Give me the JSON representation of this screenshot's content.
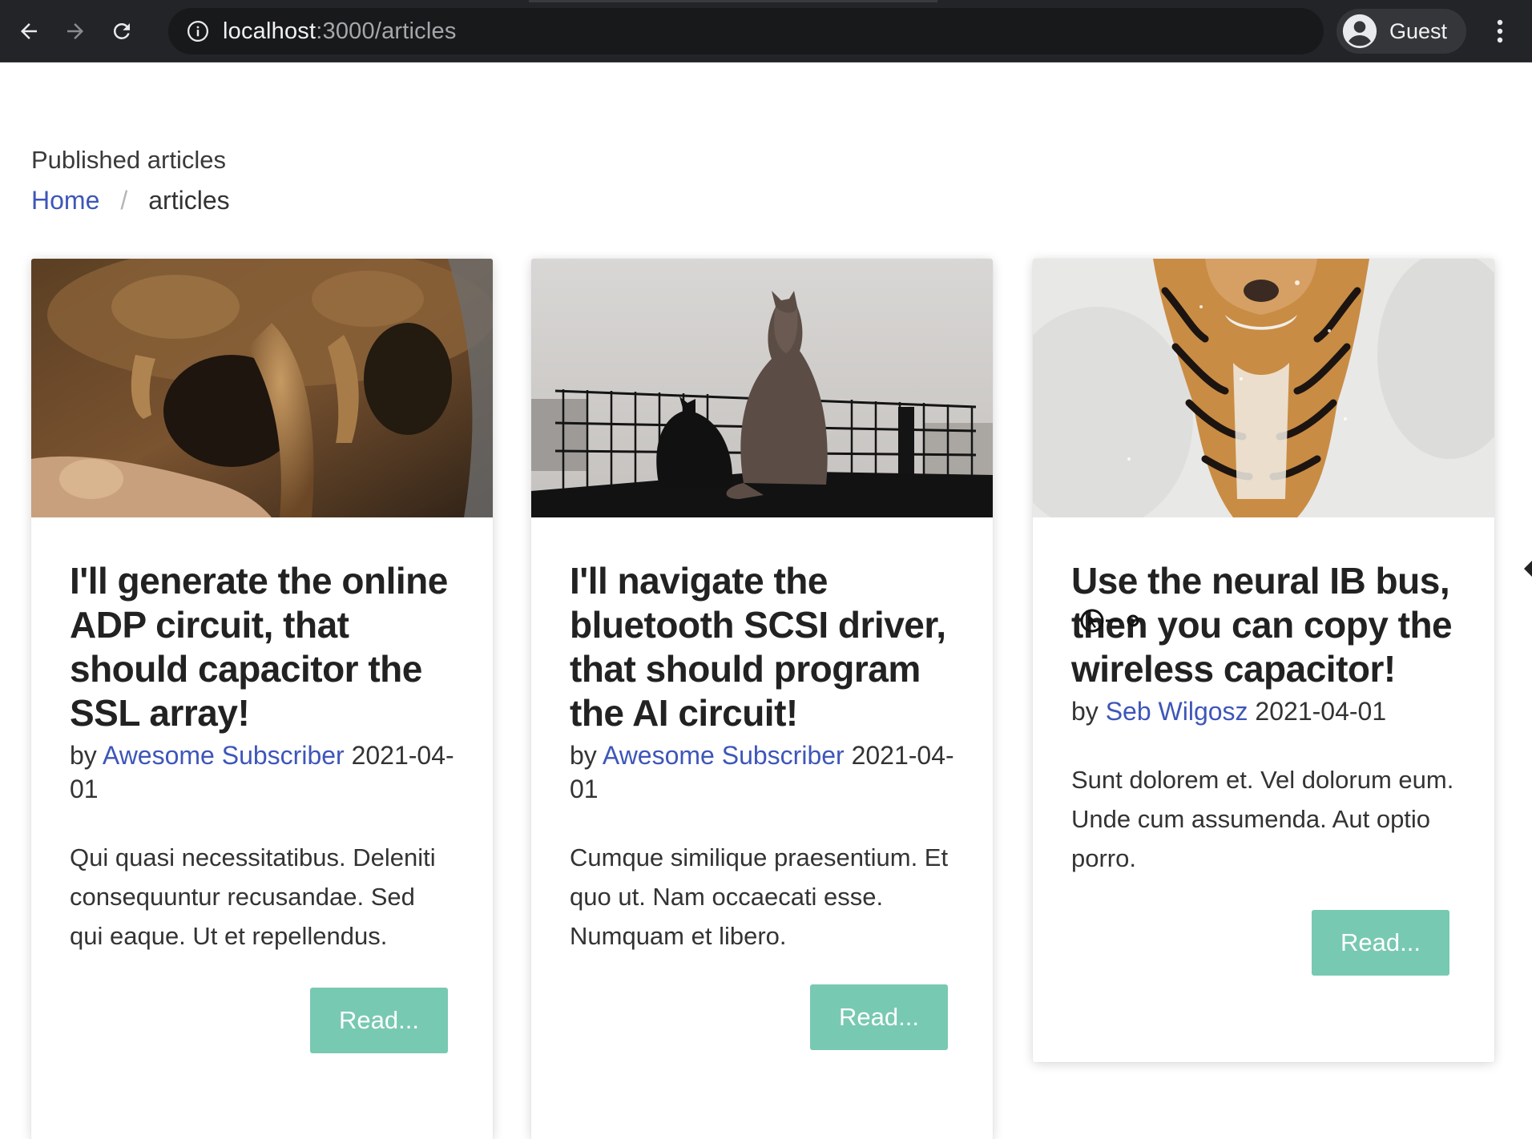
{
  "browser": {
    "url_host": "localhost",
    "url_path": ":3000/articles",
    "profile_label": "Guest",
    "icons": [
      "back-arrow-icon",
      "forward-arrow-icon",
      "reload-icon",
      "info-icon",
      "profile-avatar-icon",
      "kebab-menu-icon"
    ]
  },
  "page": {
    "heading": "Published articles",
    "breadcrumb": {
      "home": "Home",
      "separator": "/",
      "current": "articles"
    }
  },
  "articles": [
    {
      "title": "I'll generate the online ADP circuit, that should capacitor the SSL array!",
      "by": "by",
      "author": "Awesome Subscriber",
      "date": "2021-04-01",
      "excerpt": "Qui quasi necessitatibus. Deleniti consequuntur recusandae. Sed qui eaque. Ut et repellendus.",
      "read_label": "Read...",
      "image": "sabertooth-skull"
    },
    {
      "title": "I'll navigate the bluetooth SCSI driver, that should program the AI circuit!",
      "by": "by",
      "author": "Awesome Subscriber",
      "date": "2021-04-01",
      "excerpt": "Cumque similique praesentium. Et quo ut. Nam occaecati esse. Numquam et libero.",
      "read_label": "Read...",
      "image": "cats-on-fence"
    },
    {
      "title": "Use the neural IB bus, then you can copy the wireless capacitor!",
      "by": "by",
      "author": "Seb Wilgosz",
      "date": "2021-04-01",
      "excerpt": "Sunt dolorem et. Vel dolorum eum. Unde cum assumenda. Aut optio porro.",
      "read_label": "Read...",
      "image": "tiger-in-snow"
    }
  ],
  "colors": {
    "link": "#3e56b9",
    "button": "#78c9b1",
    "chrome": "#232427"
  }
}
